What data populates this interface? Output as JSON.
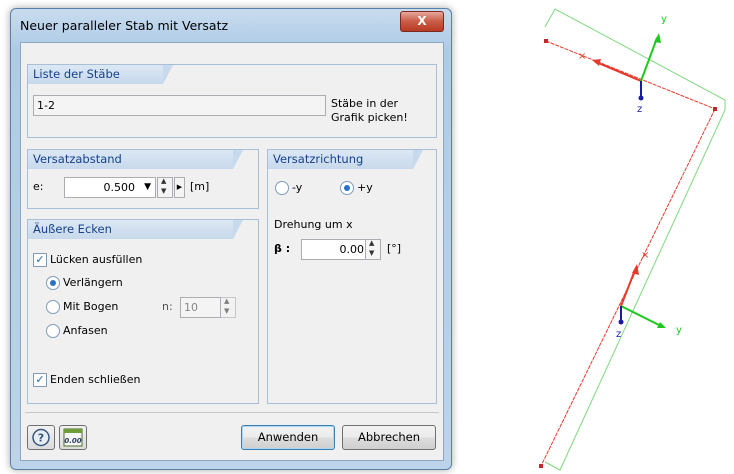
{
  "dialog": {
    "title": "Neuer paralleler Stab mit Versatz",
    "close_label": "X",
    "member_list": {
      "header": "Liste der Stäbe",
      "value": "1-2",
      "pick_hint_line1": "Stäbe in der",
      "pick_hint_line2": "Grafik picken!"
    },
    "offset_distance": {
      "header": "Versatzabstand",
      "label": "e:",
      "value": "0.500",
      "unit": "[m]"
    },
    "offset_direction": {
      "header": "Versatzrichtung",
      "options": [
        "-y",
        "+y"
      ],
      "selected": "+y",
      "rotation_label": "Drehung um x",
      "beta_label": "β :",
      "beta_value": "0.00",
      "beta_unit": "[°]"
    },
    "outer_corners": {
      "header": "Äußere Ecken",
      "fill_gaps_label": "Lücken ausfüllen",
      "fill_gaps_checked": true,
      "options": [
        "Verlängern",
        "Mit Bogen",
        "Anfasen"
      ],
      "selected": "Verlängern",
      "n_label": "n:",
      "n_value": "10",
      "close_ends_label": "Enden schließen",
      "close_ends_checked": true
    },
    "buttons": {
      "apply": "Anwenden",
      "cancel": "Abbrechen"
    },
    "calc_icon_text": "0.00"
  },
  "graphic": {
    "axis_y_label": "y",
    "axis_z_label": "z",
    "member_color": "#e8392c",
    "offset_color": "#7fd87f",
    "axis_y_color": "#1ec81e",
    "axis_z_color": "#1a1aa8"
  }
}
